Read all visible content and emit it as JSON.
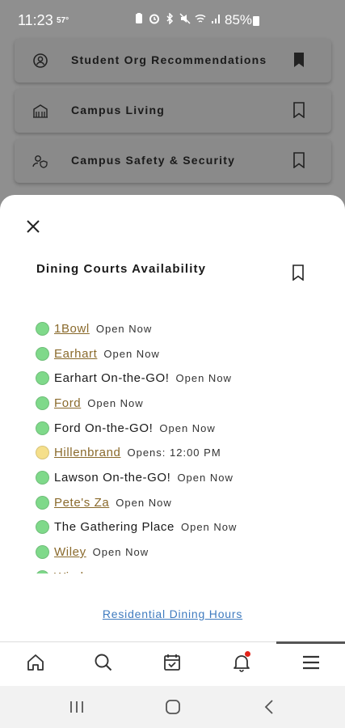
{
  "status_bar": {
    "time": "11:23",
    "temperature": "57°",
    "battery": "85%",
    "icons": [
      "battery-saver-icon",
      "alarm-icon",
      "bluetooth-icon",
      "mute-icon",
      "wifi-icon",
      "signal-icon"
    ]
  },
  "background_cards": [
    {
      "label": "Student Org Recommendations",
      "icon": "person-circle-icon",
      "bookmarked": true
    },
    {
      "label": "Campus Living",
      "icon": "building-icon",
      "bookmarked": false
    },
    {
      "label": "Campus Safety & Security",
      "icon": "person-shield-icon",
      "bookmarked": false
    }
  ],
  "sheet": {
    "title": "Dining Courts Availability",
    "footer_link": "Residential Dining Hours",
    "items": [
      {
        "name": "1Bowl",
        "status": "Open Now",
        "state": "open",
        "link": true
      },
      {
        "name": "Earhart",
        "status": "Open Now",
        "state": "open",
        "link": true
      },
      {
        "name": "Earhart On-the-GO!",
        "status": "Open Now",
        "state": "open",
        "link": false
      },
      {
        "name": "Ford",
        "status": "Open Now",
        "state": "open",
        "link": true
      },
      {
        "name": "Ford On-the-GO!",
        "status": "Open Now",
        "state": "open",
        "link": false
      },
      {
        "name": "Hillenbrand",
        "status": "Opens: 12:00 PM",
        "state": "opens",
        "link": true
      },
      {
        "name": "Lawson On-the-GO!",
        "status": "Open Now",
        "state": "open",
        "link": false
      },
      {
        "name": "Pete's Za",
        "status": "Open Now",
        "state": "open",
        "link": true
      },
      {
        "name": "The Gathering Place",
        "status": "Open Now",
        "state": "open",
        "link": false
      },
      {
        "name": "Wiley",
        "status": "Open Now",
        "state": "open",
        "link": true
      },
      {
        "name": "Windsor",
        "status": "Open Now",
        "state": "open",
        "link": true
      }
    ]
  },
  "bottom_nav": {
    "items": [
      "home-icon",
      "search-icon",
      "calendar-check-icon",
      "notification-bell-icon",
      "menu-icon"
    ],
    "active": "menu-icon",
    "has_notification": true
  },
  "colors": {
    "open_dot": "#7fd98a",
    "opens_dot": "#f5df8a",
    "link_gold": "#8a6a2c",
    "link_blue": "#3f7bbf",
    "notification": "#e2231a"
  }
}
